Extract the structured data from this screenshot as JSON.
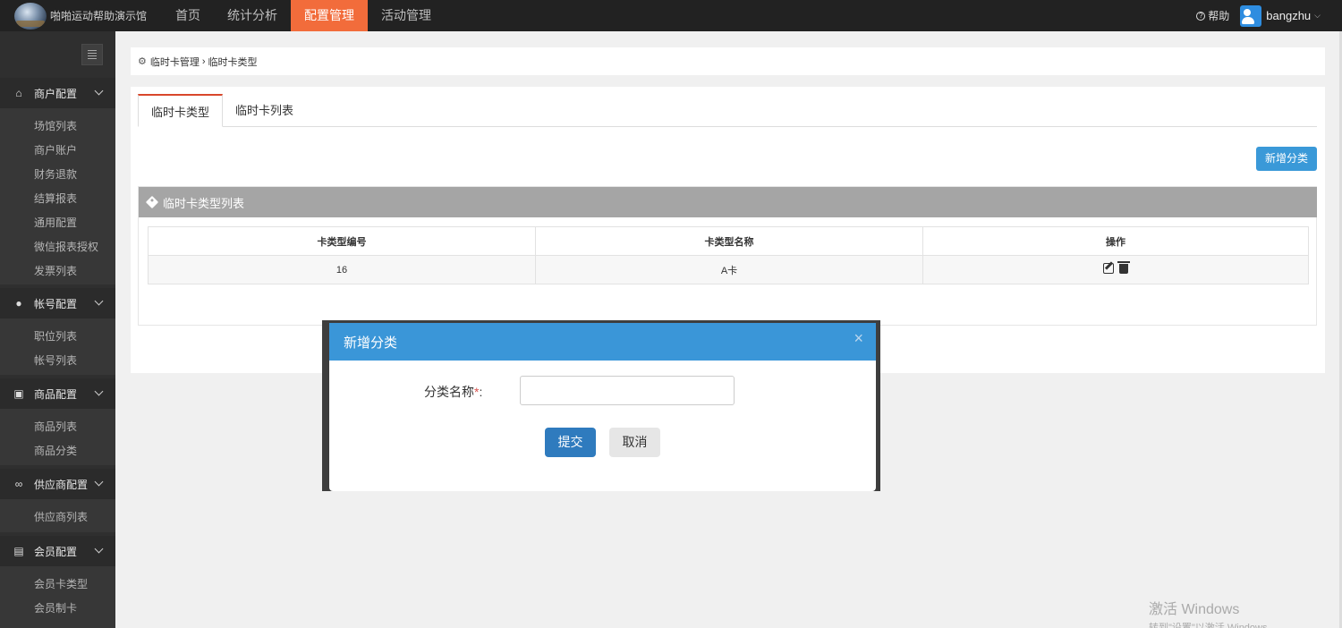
{
  "app": {
    "brand": "啪啪运动帮助演示馆"
  },
  "nav": {
    "items": [
      {
        "label": "首页"
      },
      {
        "label": "统计分析"
      },
      {
        "label": "配置管理"
      },
      {
        "label": "活动管理"
      }
    ],
    "active": "配置管理",
    "help": "帮助",
    "user": "bangzhu"
  },
  "sidebar": {
    "groups": [
      {
        "title": "商户配置",
        "icon": "home-icon",
        "items": [
          "场馆列表",
          "商户账户",
          "财务退款",
          "结算报表",
          "通用配置",
          "微信报表授权",
          "发票列表"
        ]
      },
      {
        "title": "帐号配置",
        "icon": "user-icon",
        "items": [
          "职位列表",
          "帐号列表"
        ]
      },
      {
        "title": "商品配置",
        "icon": "gift-icon",
        "items": [
          "商品列表",
          "商品分类"
        ]
      },
      {
        "title": "供应商配置",
        "icon": "link-icon",
        "items": [
          "供应商列表"
        ]
      },
      {
        "title": "会员配置",
        "icon": "id-card-icon",
        "items": [
          "会员卡类型",
          "会员制卡"
        ]
      }
    ]
  },
  "breadcrumb": {
    "parent": "临时卡管理",
    "current": "临时卡类型"
  },
  "tabs": [
    {
      "label": "临时卡类型"
    },
    {
      "label": "临时卡列表"
    }
  ],
  "add_button": "新增分类",
  "section_title": "临时卡类型列表",
  "table": {
    "columns": [
      "卡类型编号",
      "卡类型名称",
      "操作"
    ],
    "rows": [
      {
        "id": "16",
        "name": "A卡"
      }
    ]
  },
  "modal": {
    "title": "新增分类",
    "close": "×",
    "field_label": "分类名称",
    "required_mark": "*",
    "field_colon": ":",
    "field_value": "",
    "submit": "提交",
    "cancel": "取消"
  },
  "watermark": {
    "title": "激活 Windows",
    "subtitle": "转到\"设置\"以激活 Windows。"
  },
  "colors": {
    "accent": "#f26c3b",
    "primary": "#3a99d8",
    "modal_header": "#3a96d8",
    "submit": "#2f7bbe"
  }
}
